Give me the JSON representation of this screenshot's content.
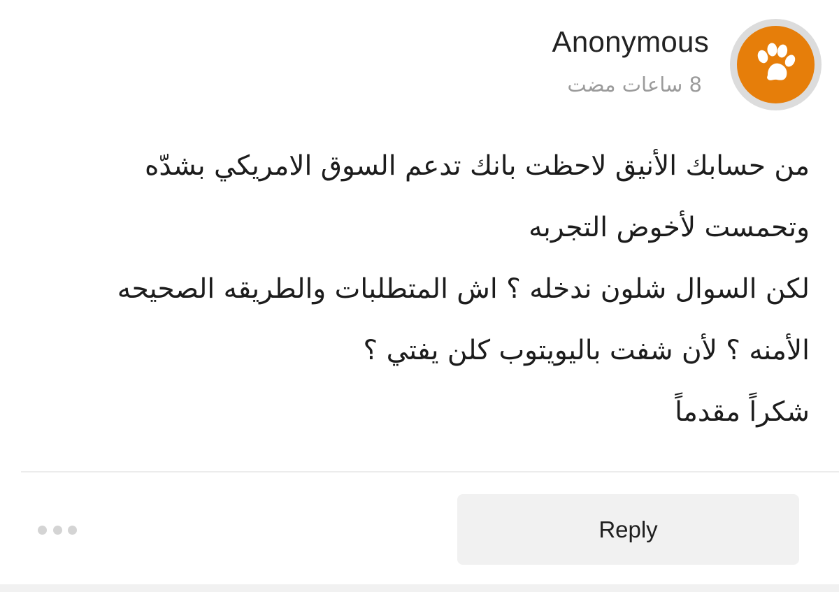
{
  "comment": {
    "author": "Anonymous",
    "avatar_icon": "paw-icon",
    "avatar_color": "#e67e0a",
    "timestamp": "8 ساعات مضت",
    "message_lines": [
      "من حسابك الأنيق لاحظت بانك تدعم السوق الامريكي بشدّه",
      "وتحمست لأخوض التجربه",
      "لكن السوال شلون ندخله ؟ اش المتطلبات والطريقه الصحيحه",
      "الأمنه ؟ لأن شفت باليويتوب كلن يفتي ؟",
      "شكراً مقدماً"
    ]
  },
  "actions": {
    "reply_label": "Reply",
    "more_icon": "more-horizontal-icon"
  }
}
